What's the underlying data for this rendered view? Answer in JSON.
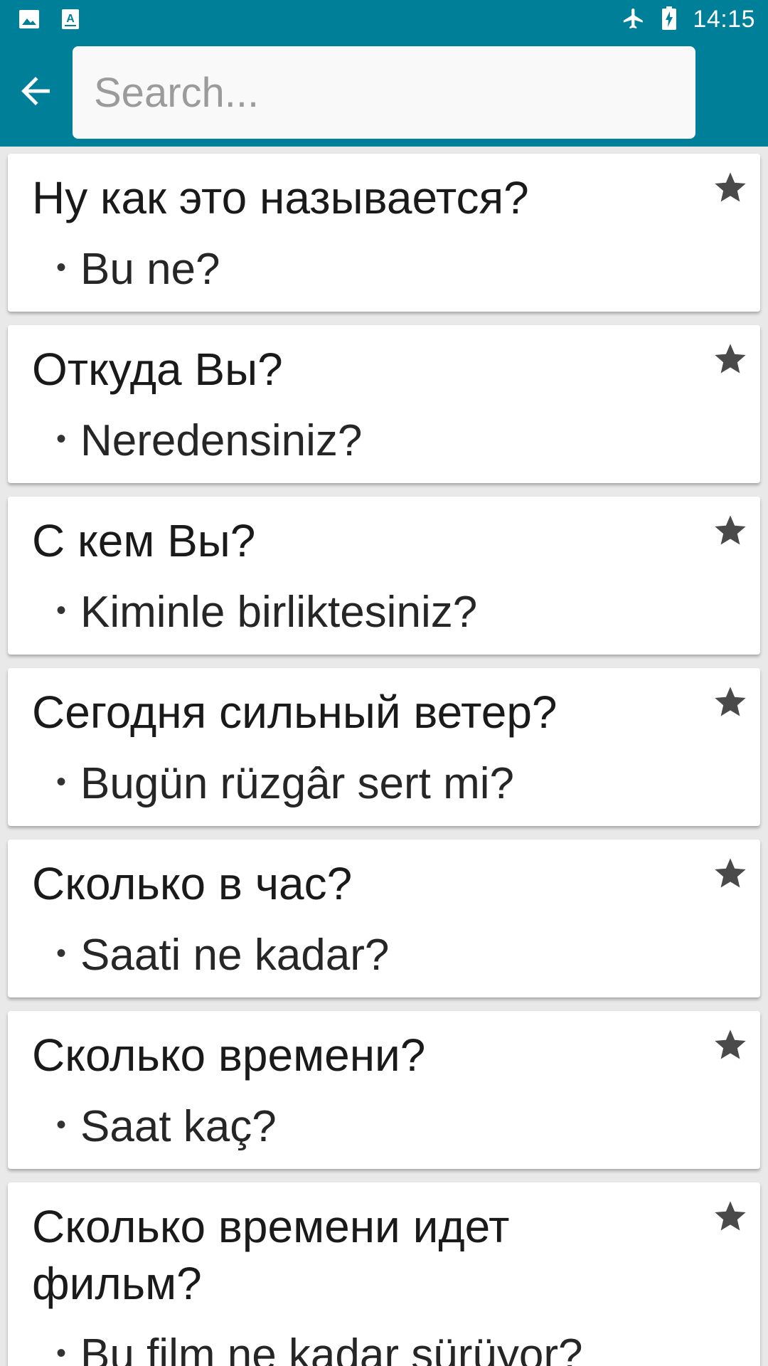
{
  "status_bar": {
    "time": "14:15",
    "icons": [
      "image-icon",
      "text-recognition-icon",
      "airplane-icon",
      "battery-charging-icon"
    ]
  },
  "toolbar": {
    "back_icon": "arrow-left-icon",
    "search": {
      "value": "",
      "placeholder": "Search..."
    }
  },
  "colors": {
    "app_bar": "#007f98",
    "list_background": "#e9e9e9",
    "card": "#ffffff",
    "star": "#4a4a4a"
  },
  "phrases": [
    {
      "question": "Ну как это называется?",
      "answer": "Bu ne?",
      "favorite_icon": "star-icon"
    },
    {
      "question": "Откуда Вы?",
      "answer": "Neredensiniz?",
      "favorite_icon": "star-icon"
    },
    {
      "question": "С кем Вы?",
      "answer": "Kiminle birliktesiniz?",
      "favorite_icon": "star-icon"
    },
    {
      "question": "Сегодня сильный ветер?",
      "answer": "Bugün rüzgâr sert mi?",
      "favorite_icon": "star-icon"
    },
    {
      "question": "Сколько в час?",
      "answer": "Saati ne kadar?",
      "favorite_icon": "star-icon"
    },
    {
      "question": "Сколько времени?",
      "answer": "Saat kaç?",
      "favorite_icon": "star-icon"
    },
    {
      "question": "Сколько времени идет фильм?",
      "answer": "Bu film ne kadar sürüyor?",
      "favorite_icon": "star-icon"
    }
  ]
}
